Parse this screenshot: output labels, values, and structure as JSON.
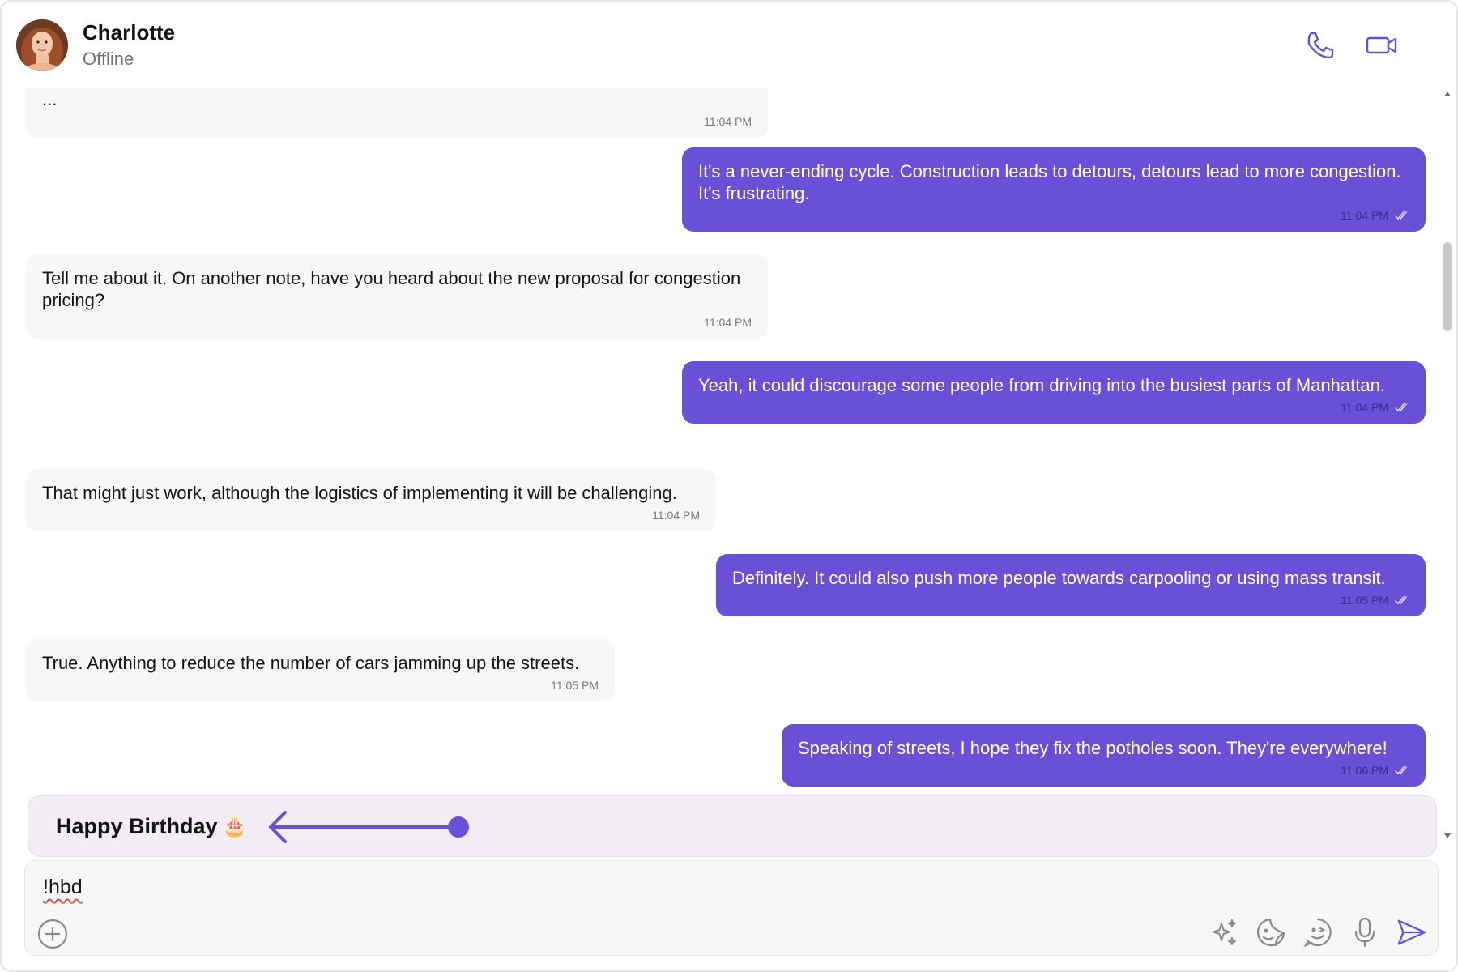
{
  "header": {
    "user_name": "Charlotte",
    "status": "Offline",
    "icons": [
      "phone-icon",
      "video-call-icon"
    ]
  },
  "messages": [
    {
      "direction": "incoming",
      "text": "...",
      "time": "11:04 PM"
    },
    {
      "direction": "outgoing",
      "text": "It's a never-ending cycle. Construction leads to detours, detours lead to more congestion. It's frustrating.",
      "time": "11:04 PM",
      "receipt": "read"
    },
    {
      "direction": "incoming",
      "text": "Tell me about it. On another note, have you heard about the new proposal for congestion pricing?",
      "time": "11:04 PM"
    },
    {
      "direction": "outgoing",
      "text": "Yeah, it could discourage some people from driving into the busiest parts of Manhattan.",
      "time": "11:04 PM",
      "receipt": "read"
    },
    {
      "direction": "incoming",
      "text": "That might just work, although the logistics of implementing it will be challenging.",
      "time": "11:04 PM"
    },
    {
      "direction": "outgoing",
      "text": "Definitely. It could also push more people towards carpooling or using mass transit.",
      "time": "11:05 PM",
      "receipt": "read"
    },
    {
      "direction": "incoming",
      "text": "True. Anything to reduce the number of cars jamming up the streets.",
      "time": "11:05 PM"
    },
    {
      "direction": "outgoing",
      "text": "Speaking of streets, I hope they fix the potholes soon. They're everywhere!",
      "time": "11:06 PM",
      "receipt": "read"
    }
  ],
  "suggestion": {
    "text": "Happy Birthday",
    "emoji": "🎂"
  },
  "composer": {
    "value": "!hbd",
    "icons": [
      "add-icon",
      "ai-sparkle-icon",
      "sticker-icon",
      "emoji-icon",
      "microphone-icon",
      "send-icon"
    ]
  },
  "colors": {
    "accent": "#6851d6",
    "incoming_bubble": "#f7f7f7",
    "suggestion_bg": "#f2edf4"
  }
}
